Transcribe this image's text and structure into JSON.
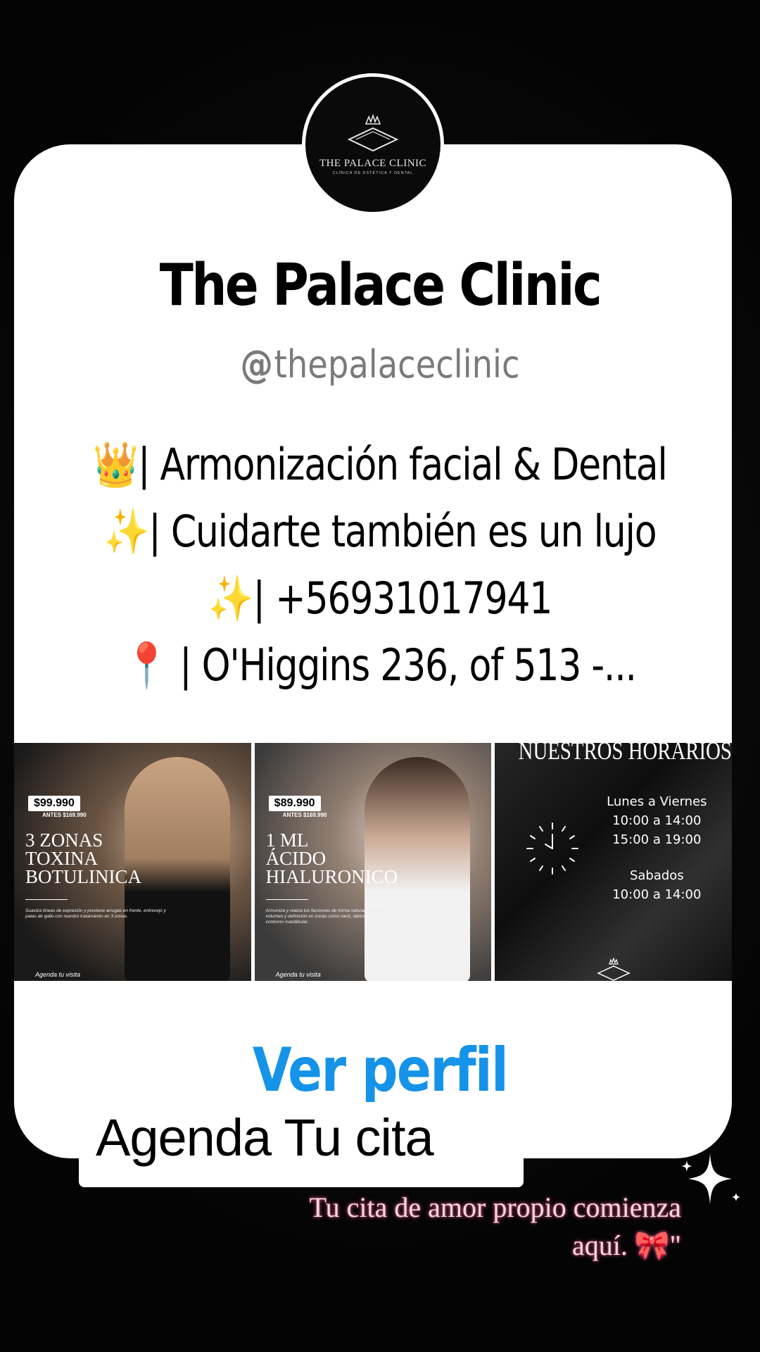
{
  "profile": {
    "logo_name": "THE PALACE CLINIC",
    "logo_subtitle": "CLÍNICA DE ESTÉTICA Y DENTAL",
    "name": "The Palace Clinic",
    "threads_glyph": "@",
    "handle": "thepalaceclinic",
    "bio": [
      {
        "emoji": "👑",
        "text": "| Armonización facial & Dental"
      },
      {
        "emoji": "✨",
        "text": "| Cuidarte también es un lujo"
      },
      {
        "emoji": "✨",
        "text": "| +56931017941"
      },
      {
        "emoji": "📍",
        "text": " | O'Higgins 236, of 513 -..."
      }
    ],
    "view_profile_label": "Ver perfil"
  },
  "posts": [
    {
      "price": "$99.990",
      "before": "ANTES $169.990",
      "title": "3 ZONAS\nTOXINA\nBOTULINICA",
      "description": "Suaviza líneas de expresión y previene arrugas en frente, entrecejo y patas de gallo con nuestro tratamiento en 3 zonas.",
      "cta": "Agenda tu visita"
    },
    {
      "price": "$89.990",
      "before": "ANTES $169.990",
      "title": "1 ML\nÁCIDO\nHIALURONICO",
      "description": "Armoniza y realza tus facciones de forma natural, aportando volumen y definición en zonas como nariz, labios, mentón, ojeras y contorno mandibular.",
      "cta": "Agenda tu visita"
    },
    {
      "title": "NUESTROS HORARIOS",
      "weekdays_label": "Lunes a Viernes",
      "weekdays_morning": "10:00 a 14:00",
      "weekdays_afternoon": "15:00 a 19:00",
      "saturday_label": "Sabados",
      "saturday_hours": "10:00 a 14:00"
    }
  ],
  "overlay": {
    "agenda_label": "Agenda Tu cita",
    "caption_line1": "Tu cita de amor propio comienza",
    "caption_line2": "aquí. 🎀\""
  },
  "colors": {
    "background": "#050505",
    "card": "#ffffff",
    "link_blue": "#1593e8",
    "handle_gray": "#7a7a7a",
    "caption_glow": "#c24d79"
  }
}
